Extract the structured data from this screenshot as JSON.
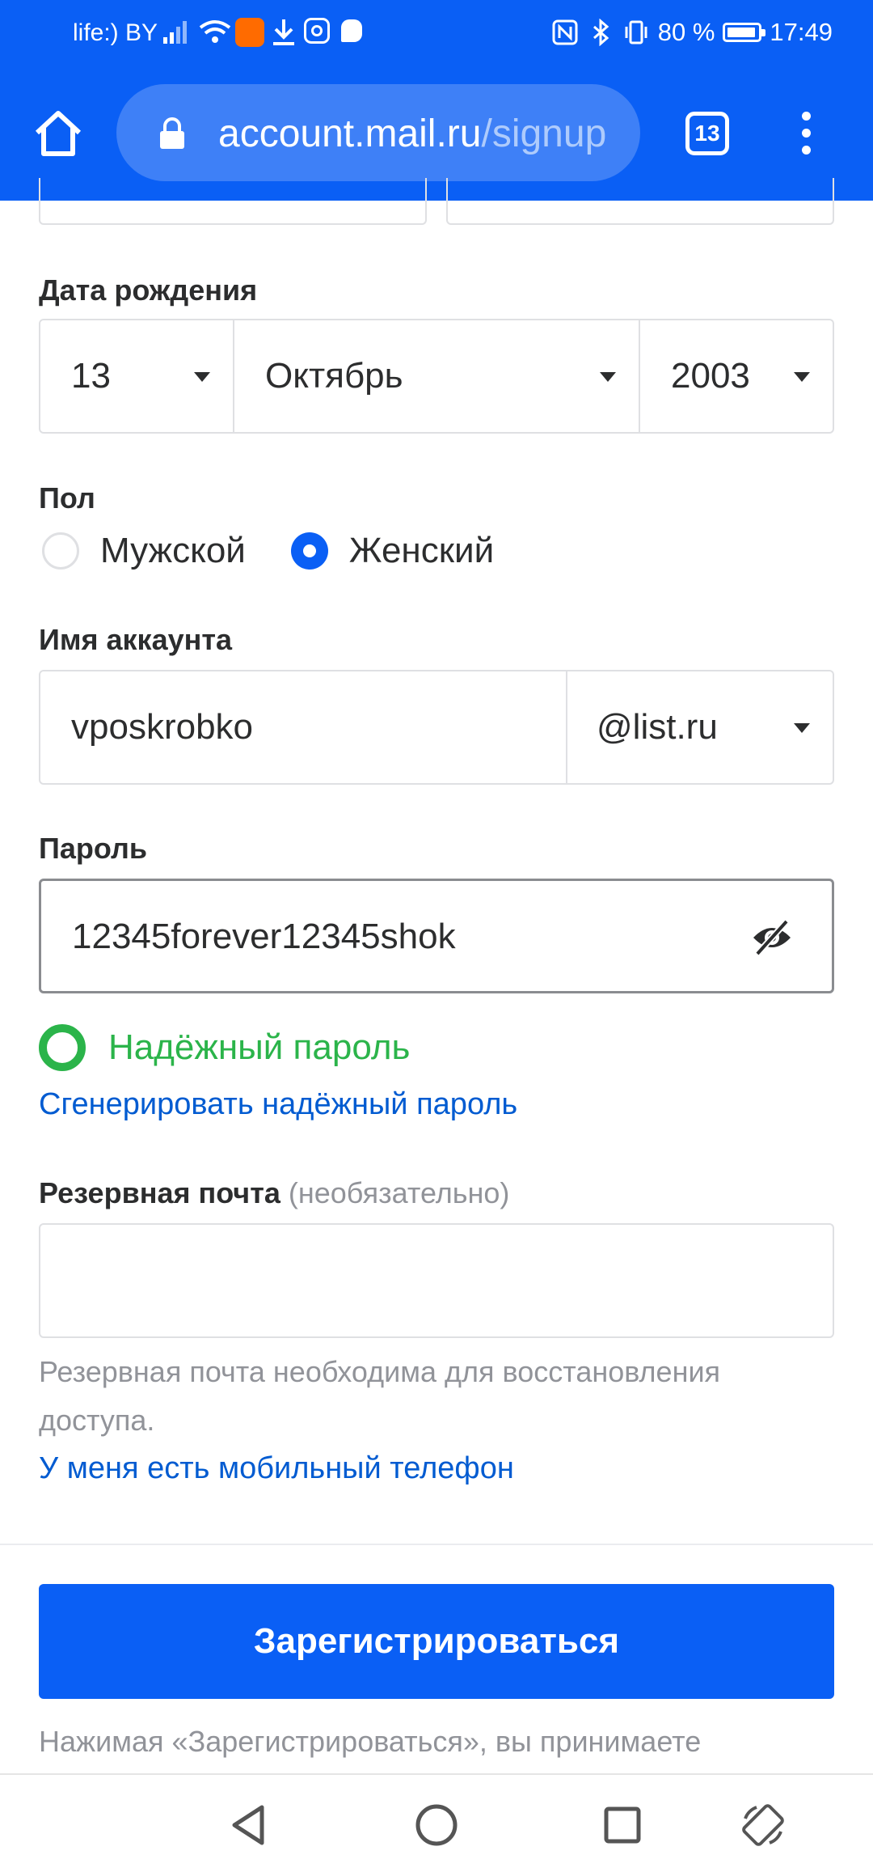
{
  "status_bar": {
    "carrier": "life:) BY",
    "battery": "80 %",
    "time": "17:49"
  },
  "browser": {
    "url_host": "account.mail.ru",
    "url_path": "/signup",
    "tab_count": "13"
  },
  "form": {
    "birthdate_label": "Дата рождения",
    "day": "13",
    "month": "Октябрь",
    "year": "2003",
    "gender_label": "Пол",
    "gender_male": "Мужской",
    "gender_female": "Женский",
    "gender_selected": "female",
    "account_label": "Имя аккаунта",
    "account_value": "vposkrobko",
    "domain": "@list.ru",
    "password_label": "Пароль",
    "password_value": "12345forever12345shok",
    "strength_text": "Надёжный пароль",
    "generate_link": "Сгенерировать надёжный пароль",
    "backup_label": "Резервная почта",
    "backup_optional": "(необязательно)",
    "backup_value": "",
    "backup_hint": "Резервная почта необходима для восстановления доступа.",
    "phone_link": "У меня есть мобильный телефон",
    "submit_label": "Зарегистрироваться",
    "terms_text": "Нажимая «Зарегистрироваться», вы принимаете"
  },
  "colors": {
    "brand_blue": "#0a5ff5",
    "success_green": "#2bb44a",
    "link_blue": "#005bd1"
  }
}
